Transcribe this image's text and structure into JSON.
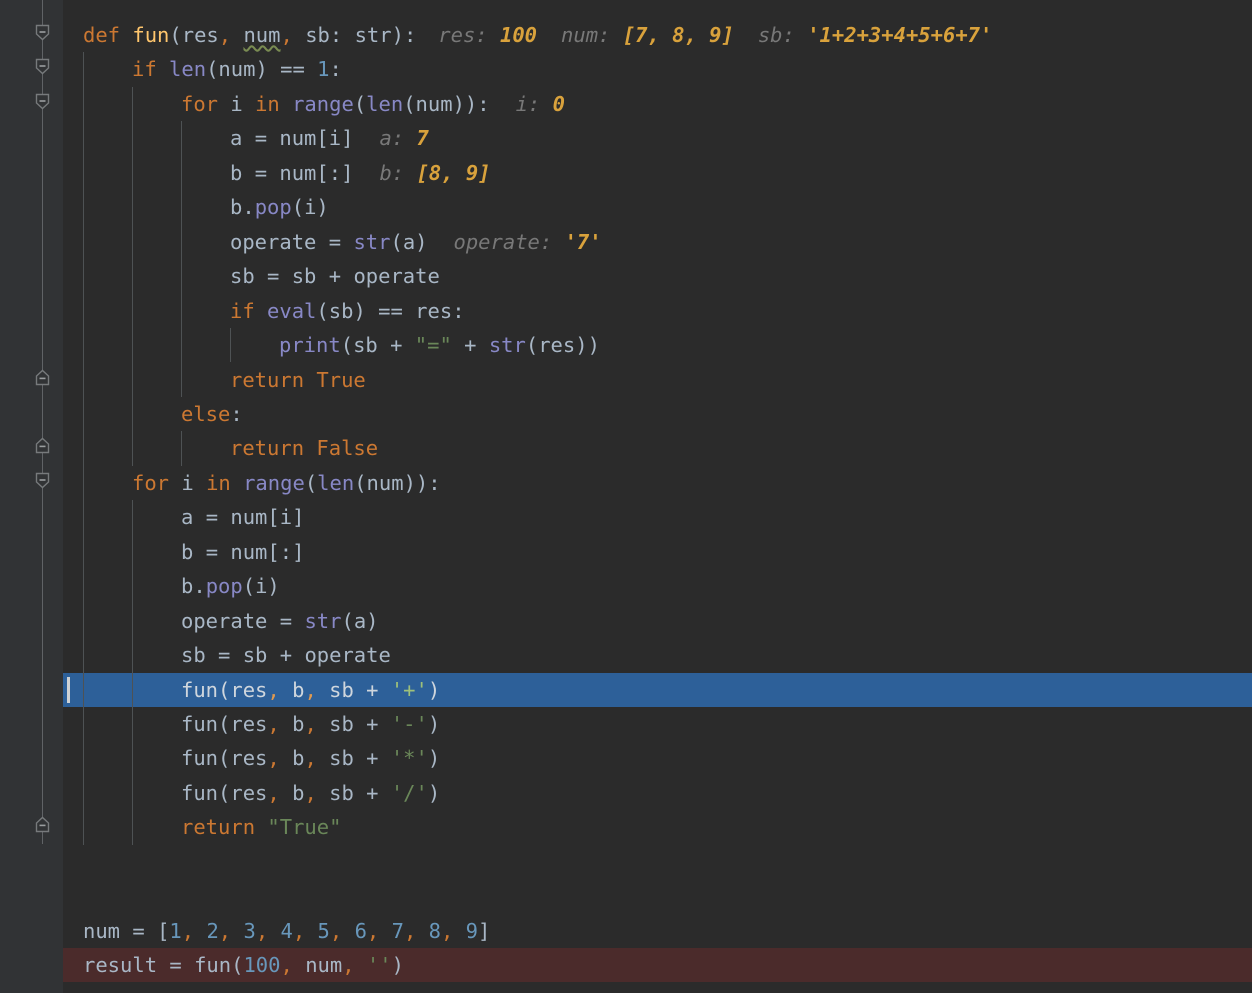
{
  "editor": {
    "theme_name": "darcula",
    "colors": {
      "background": "#2b2b2b",
      "gutter": "#313335",
      "selection": "#2d6099",
      "error_line": "#4b2b2b",
      "keyword": "#cc7832",
      "function_decl": "#ffc66d",
      "builtin": "#8888c6",
      "number": "#6897bb",
      "string": "#6a8759",
      "identifier": "#a9b7c6",
      "hint_label": "#787878",
      "hint_value": "#d9a23c",
      "indent_guide": "#4e5254",
      "fold_marker": "#606366"
    },
    "language": "python",
    "caret": {
      "line_index": 18,
      "column": 8
    }
  },
  "fold_markers": [
    {
      "type": "fold-expanded-icon",
      "line": 0
    },
    {
      "type": "fold-expanded-icon",
      "line": 1
    },
    {
      "type": "fold-expanded-icon",
      "line": 2
    },
    {
      "type": "fold-end-icon",
      "line": 10
    },
    {
      "type": "fold-end-icon",
      "line": 12
    },
    {
      "type": "fold-expanded-icon",
      "line": 13
    },
    {
      "type": "fold-end-icon",
      "line": 23
    }
  ],
  "lines": [
    {
      "index": 0,
      "indent": 0,
      "state": "normal",
      "text": "def fun(res, num, sb: str):",
      "hints": "res: 100   num: [7, 8, 9]   sb: '1+2+3+4+5+6+7'"
    },
    {
      "index": 1,
      "indent": 1,
      "state": "normal",
      "text": "if len(num) == 1:",
      "hints": ""
    },
    {
      "index": 2,
      "indent": 2,
      "state": "normal",
      "text": "for i in range(len(num)):",
      "hints": "i: 0"
    },
    {
      "index": 3,
      "indent": 3,
      "state": "normal",
      "text": "a = num[i]",
      "hints": "a: 7"
    },
    {
      "index": 4,
      "indent": 3,
      "state": "normal",
      "text": "b = num[:]",
      "hints": "b: [8, 9]"
    },
    {
      "index": 5,
      "indent": 3,
      "state": "normal",
      "text": "b.pop(i)",
      "hints": ""
    },
    {
      "index": 6,
      "indent": 3,
      "state": "normal",
      "text": "operate = str(a)",
      "hints": "operate: '7'"
    },
    {
      "index": 7,
      "indent": 3,
      "state": "normal",
      "text": "sb = sb + operate",
      "hints": ""
    },
    {
      "index": 8,
      "indent": 3,
      "state": "normal",
      "text": "if eval(sb) == res:",
      "hints": ""
    },
    {
      "index": 9,
      "indent": 4,
      "state": "normal",
      "text": "print(sb + \"=\" + str(res))",
      "hints": ""
    },
    {
      "index": 10,
      "indent": 3,
      "state": "normal",
      "text": "return True",
      "hints": ""
    },
    {
      "index": 11,
      "indent": 2,
      "state": "normal",
      "text": "else:",
      "hints": ""
    },
    {
      "index": 12,
      "indent": 3,
      "state": "normal",
      "text": "return False",
      "hints": ""
    },
    {
      "index": 13,
      "indent": 1,
      "state": "normal",
      "text": "for i in range(len(num)):",
      "hints": ""
    },
    {
      "index": 14,
      "indent": 2,
      "state": "normal",
      "text": "a = num[i]",
      "hints": ""
    },
    {
      "index": 15,
      "indent": 2,
      "state": "normal",
      "text": "b = num[:]",
      "hints": ""
    },
    {
      "index": 16,
      "indent": 2,
      "state": "normal",
      "text": "b.pop(i)",
      "hints": ""
    },
    {
      "index": 17,
      "indent": 2,
      "state": "normal",
      "text": "operate = str(a)",
      "hints": ""
    },
    {
      "index": 18,
      "indent": 2,
      "state": "normal",
      "text": "sb = sb + operate",
      "hints": ""
    },
    {
      "index": 19,
      "indent": 2,
      "state": "selected",
      "text": "fun(res, b, sb + '+')",
      "hints": ""
    },
    {
      "index": 20,
      "indent": 2,
      "state": "normal",
      "text": "fun(res, b, sb + '-')",
      "hints": ""
    },
    {
      "index": 21,
      "indent": 2,
      "state": "normal",
      "text": "fun(res, b, sb + '*')",
      "hints": ""
    },
    {
      "index": 22,
      "indent": 2,
      "state": "normal",
      "text": "fun(res, b, sb + '/')",
      "hints": ""
    },
    {
      "index": 23,
      "indent": 2,
      "state": "normal",
      "text": "return \"True\"",
      "hints": ""
    },
    {
      "index": 24,
      "indent": 0,
      "state": "normal",
      "text": "",
      "hints": ""
    },
    {
      "index": 25,
      "indent": 0,
      "state": "normal",
      "text": "",
      "hints": ""
    },
    {
      "index": 26,
      "indent": 0,
      "state": "normal",
      "text": "num = [1, 2, 3, 4, 5, 6, 7, 8, 9]",
      "hints": ""
    },
    {
      "index": 27,
      "indent": 0,
      "state": "error",
      "text": "result = fun(100, num, '')",
      "hints": ""
    }
  ]
}
